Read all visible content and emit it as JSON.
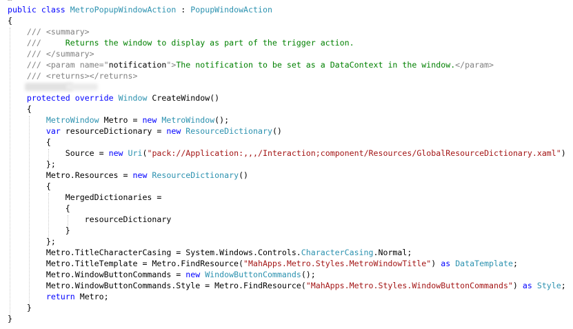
{
  "editor": {
    "partial_top_text": "…",
    "lines": [
      [
        {
          "t": "public",
          "c": "kw"
        },
        {
          "t": " "
        },
        {
          "t": "class",
          "c": "kw"
        },
        {
          "t": " "
        },
        {
          "t": "MetroPopupWindowAction",
          "c": "ty"
        },
        {
          "t": " : "
        },
        {
          "t": "PopupWindowAction",
          "c": "ty"
        }
      ],
      [
        {
          "t": "{"
        }
      ],
      [
        {
          "t": "    "
        },
        {
          "t": "/// ",
          "c": "dc"
        },
        {
          "t": "<summary>",
          "c": "dc"
        }
      ],
      [
        {
          "t": "    "
        },
        {
          "t": "/// ",
          "c": "dc"
        },
        {
          "t": "    Returns the window to display as part of the trigger action.",
          "c": "cm"
        }
      ],
      [
        {
          "t": "    "
        },
        {
          "t": "/// ",
          "c": "dc"
        },
        {
          "t": "</summary>",
          "c": "dc"
        }
      ],
      [
        {
          "t": "    "
        },
        {
          "t": "/// ",
          "c": "dc"
        },
        {
          "t": "<param name=\"",
          "c": "dc"
        },
        {
          "t": "notification"
        },
        {
          "t": "\">",
          "c": "dc"
        },
        {
          "t": "The notification to be set as a DataContext in the window.",
          "c": "cm"
        },
        {
          "t": "</param>",
          "c": "dc"
        }
      ],
      [
        {
          "t": "    "
        },
        {
          "t": "/// ",
          "c": "dc"
        },
        {
          "t": "<returns></returns>",
          "c": "dc"
        }
      ],
      [
        {
          "t": ""
        }
      ],
      [
        {
          "t": "    "
        },
        {
          "t": "protected",
          "c": "kw"
        },
        {
          "t": " "
        },
        {
          "t": "override",
          "c": "kw"
        },
        {
          "t": " "
        },
        {
          "t": "Window",
          "c": "ty"
        },
        {
          "t": " CreateWindow()"
        }
      ],
      [
        {
          "t": "    {"
        }
      ],
      [
        {
          "t": "        "
        },
        {
          "t": "MetroWindow",
          "c": "ty"
        },
        {
          "t": " Metro = "
        },
        {
          "t": "new",
          "c": "kw"
        },
        {
          "t": " "
        },
        {
          "t": "MetroWindow",
          "c": "ty"
        },
        {
          "t": "();"
        }
      ],
      [
        {
          "t": "        "
        },
        {
          "t": "var",
          "c": "kw"
        },
        {
          "t": " resourceDictionary = "
        },
        {
          "t": "new",
          "c": "kw"
        },
        {
          "t": " "
        },
        {
          "t": "ResourceDictionary",
          "c": "ty"
        },
        {
          "t": "()"
        }
      ],
      [
        {
          "t": "        {"
        }
      ],
      [
        {
          "t": "            Source = "
        },
        {
          "t": "new",
          "c": "kw"
        },
        {
          "t": " "
        },
        {
          "t": "Uri",
          "c": "ty"
        },
        {
          "t": "("
        },
        {
          "t": "\"pack://Application:,,,/Interaction;component/Resources/GlobalResourceDictionary.xaml\"",
          "c": "st"
        },
        {
          "t": ")"
        }
      ],
      [
        {
          "t": "        };"
        }
      ],
      [
        {
          "t": "        Metro.Resources = "
        },
        {
          "t": "new",
          "c": "kw"
        },
        {
          "t": " "
        },
        {
          "t": "ResourceDictionary",
          "c": "ty"
        },
        {
          "t": "()"
        }
      ],
      [
        {
          "t": "        {"
        }
      ],
      [
        {
          "t": "            MergedDictionaries ="
        }
      ],
      [
        {
          "t": "            {"
        }
      ],
      [
        {
          "t": "                resourceDictionary"
        }
      ],
      [
        {
          "t": "            }"
        }
      ],
      [
        {
          "t": "        };"
        }
      ],
      [
        {
          "t": "        Metro.TitleCharacterCasing = System.Windows.Controls."
        },
        {
          "t": "CharacterCasing",
          "c": "ty"
        },
        {
          "t": ".Normal;"
        }
      ],
      [
        {
          "t": "        Metro.TitleTemplate = Metro.FindResource("
        },
        {
          "t": "\"MahApps.Metro.Styles.MetroWindowTitle\"",
          "c": "st"
        },
        {
          "t": ") "
        },
        {
          "t": "as",
          "c": "kw"
        },
        {
          "t": " "
        },
        {
          "t": "DataTemplate",
          "c": "ty"
        },
        {
          "t": ";"
        }
      ],
      [
        {
          "t": "        Metro.WindowButtonCommands = "
        },
        {
          "t": "new",
          "c": "kw"
        },
        {
          "t": " "
        },
        {
          "t": "WindowButtonCommands",
          "c": "ty"
        },
        {
          "t": "();"
        }
      ],
      [
        {
          "t": "        Metro.WindowButtonCommands.Style = Metro.FindResource("
        },
        {
          "t": "\"MahApps.Metro.Styles.WindowButtonCommands\"",
          "c": "st"
        },
        {
          "t": ") "
        },
        {
          "t": "as",
          "c": "kw"
        },
        {
          "t": " "
        },
        {
          "t": "Style",
          "c": "ty"
        },
        {
          "t": ";"
        }
      ],
      [
        {
          "t": "        "
        },
        {
          "t": "return",
          "c": "kw"
        },
        {
          "t": " Metro;"
        }
      ],
      [
        {
          "t": "    }"
        }
      ],
      [
        {
          "t": "}"
        }
      ]
    ]
  }
}
